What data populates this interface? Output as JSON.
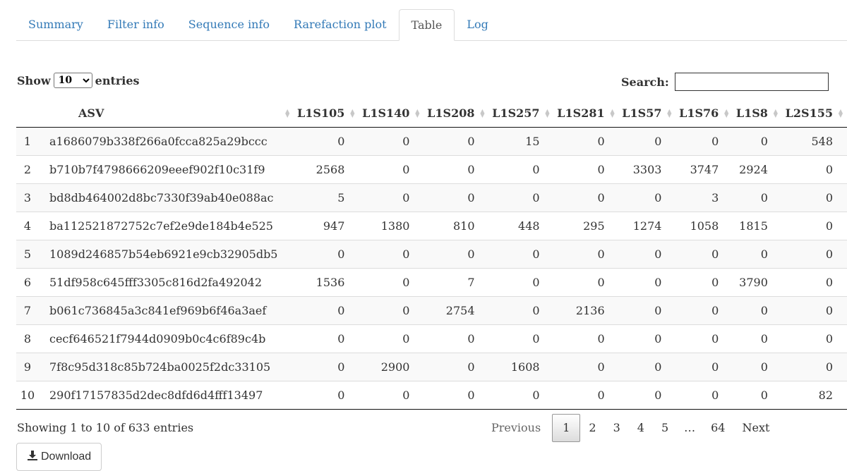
{
  "tabs": [
    "Summary",
    "Filter info",
    "Sequence info",
    "Rarefaction plot",
    "Table",
    "Log"
  ],
  "active_tab": "Table",
  "length_control": {
    "show_label": "Show",
    "value": "10",
    "entries_label": "entries"
  },
  "search": {
    "label": "Search:",
    "value": ""
  },
  "table": {
    "columns": [
      "",
      "ASV",
      "L1S105",
      "L1S140",
      "L1S208",
      "L1S257",
      "L1S281",
      "L1S57",
      "L1S76",
      "L1S8",
      "L2S155"
    ],
    "rows": [
      [
        "1",
        "a1686079b338f266a0fcca825a29bccc",
        "0",
        "0",
        "0",
        "15",
        "0",
        "0",
        "0",
        "0",
        "548"
      ],
      [
        "2",
        "b710b7f4798666209eeef902f10c31f9",
        "2568",
        "0",
        "0",
        "0",
        "0",
        "3303",
        "3747",
        "2924",
        "0"
      ],
      [
        "3",
        "bd8db464002d8bc7330f39ab40e088ac",
        "5",
        "0",
        "0",
        "0",
        "0",
        "0",
        "3",
        "0",
        "0"
      ],
      [
        "4",
        "ba112521872752c7ef2e9de184b4e525",
        "947",
        "1380",
        "810",
        "448",
        "295",
        "1274",
        "1058",
        "1815",
        "0"
      ],
      [
        "5",
        "1089d246857b54eb6921e9cb32905db5",
        "0",
        "0",
        "0",
        "0",
        "0",
        "0",
        "0",
        "0",
        "0"
      ],
      [
        "6",
        "51df958c645fff3305c816d2fa492042",
        "1536",
        "0",
        "7",
        "0",
        "0",
        "0",
        "0",
        "3790",
        "0"
      ],
      [
        "7",
        "b061c736845a3c841ef969b6f46a3aef",
        "0",
        "0",
        "2754",
        "0",
        "2136",
        "0",
        "0",
        "0",
        "0"
      ],
      [
        "8",
        "cecf646521f7944d0909b0c4c6f89c4b",
        "0",
        "0",
        "0",
        "0",
        "0",
        "0",
        "0",
        "0",
        "0"
      ],
      [
        "9",
        "7f8c95d318c85b724ba0025f2dc33105",
        "0",
        "2900",
        "0",
        "1608",
        "0",
        "0",
        "0",
        "0",
        "0"
      ],
      [
        "10",
        "290f17157835d2dec8dfd6d4fff13497",
        "0",
        "0",
        "0",
        "0",
        "0",
        "0",
        "0",
        "0",
        "82"
      ]
    ]
  },
  "info": "Showing 1 to 10 of 633 entries",
  "pagination": {
    "previous": "Previous",
    "pages": [
      "1",
      "2",
      "3",
      "4",
      "5",
      "…",
      "64"
    ],
    "current": "1",
    "next": "Next"
  },
  "download": {
    "label": "Download",
    "icon": "download-icon"
  }
}
